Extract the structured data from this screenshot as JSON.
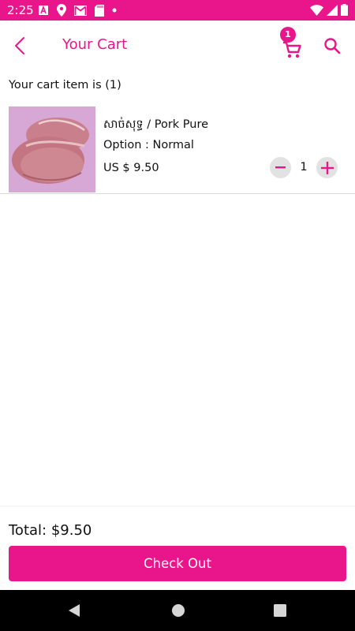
{
  "status_bar": {
    "time": "2:25"
  },
  "header": {
    "title": "Your Cart",
    "cart_badge_count": "1"
  },
  "cart": {
    "summary": "Your cart item is (1)",
    "items": [
      {
        "name": "សាច់សុទ្ធ / Pork Pure",
        "option": "Option : Normal",
        "price": "US $ 9.50",
        "quantity": "1"
      }
    ]
  },
  "footer": {
    "total": "Total: $9.50",
    "checkout_label": "Check Out"
  },
  "colors": {
    "accent": "#e8168a",
    "qty_button_bg": "#e2e2e2",
    "nav_bar": "#000000"
  },
  "icons": {
    "back": "chevron-left-icon",
    "cart": "shopping-cart-icon",
    "search": "search-icon",
    "decrement": "minus-icon",
    "increment": "plus-icon"
  }
}
